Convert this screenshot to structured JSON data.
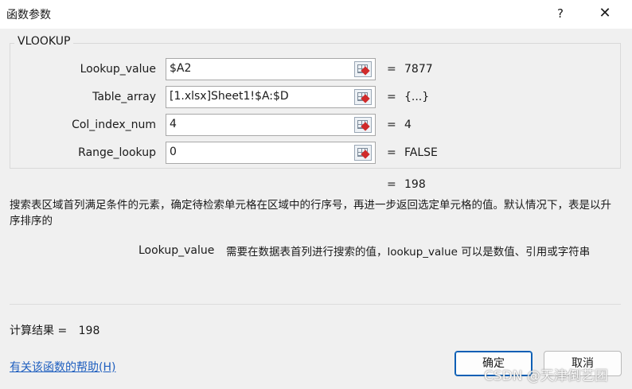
{
  "window": {
    "title": "函数参数",
    "help_label": "?",
    "close_label": "✕"
  },
  "function_name": "VLOOKUP",
  "args": [
    {
      "label": "Lookup_value",
      "value": "$A2",
      "result": "7877"
    },
    {
      "label": "Table_array",
      "value": "[1.xlsx]Sheet1!$A:$D",
      "result": "{...}"
    },
    {
      "label": "Col_index_num",
      "value": "4",
      "result": "4"
    },
    {
      "label": "Range_lookup",
      "value": "0",
      "result": "FALSE"
    }
  ],
  "equals_sign": "=",
  "formula_result": "198",
  "description": "搜索表区域首列满足条件的元素，确定待检索单元格在区域中的行序号，再进一步返回选定单元格的值。默认情况下，表是以升序排序的",
  "current_arg": {
    "name": "Lookup_value",
    "description": "需要在数据表首列进行搜索的值，lookup_value 可以是数值、引用或字符串"
  },
  "calc_result": {
    "label": "计算结果 =",
    "value": "198"
  },
  "help_link": "有关该函数的帮助(H)",
  "buttons": {
    "ok": "确定",
    "cancel": "取消"
  },
  "watermark": "CSDN @天津倒艺团",
  "icons": {
    "ref": "range-select-icon"
  }
}
